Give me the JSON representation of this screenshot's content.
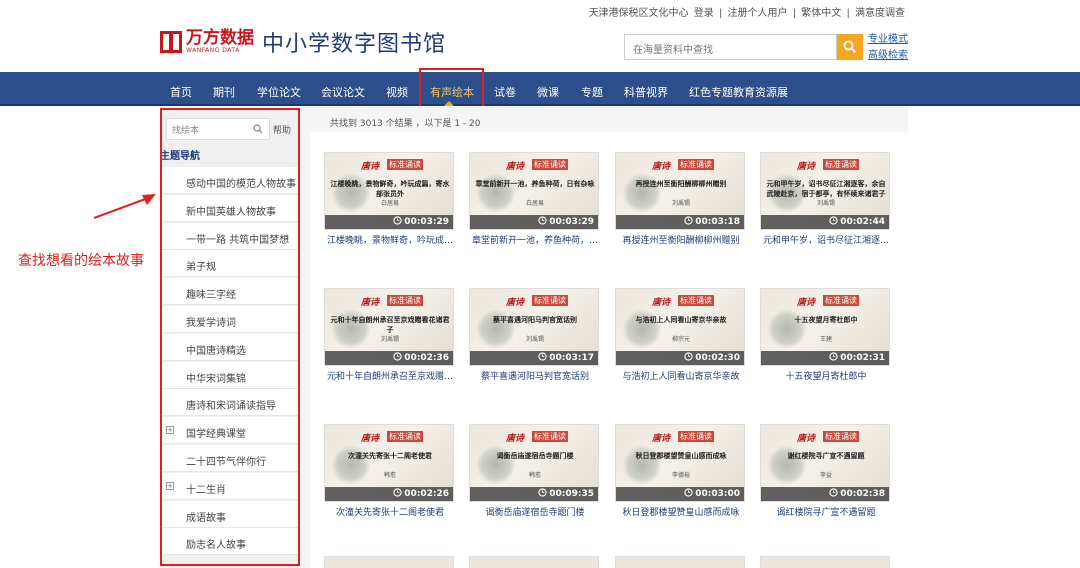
{
  "top_links": [
    "天津港保税区文化中心",
    "登录",
    "|",
    "注册个人用户",
    "|",
    "繁体中文",
    "|",
    "满意度调查"
  ],
  "logo": {
    "brand_cn": "万方数据",
    "brand_en": "WANFANG DATA",
    "title": "中小学数字图书馆"
  },
  "search": {
    "placeholder": "在海量资料中查找",
    "pro_mode": "专业模式",
    "advanced": "高级检索"
  },
  "nav": {
    "items": [
      "首页",
      "期刊",
      "学位论文",
      "会议论文",
      "视频",
      "有声绘本",
      "试卷",
      "微课",
      "专题",
      "科普视界",
      "红色专题教育资源展"
    ],
    "active": "有声绘本"
  },
  "sidebar": {
    "search_placeholder": "找绘本",
    "help": "帮助",
    "header": "主题导航",
    "items": [
      {
        "label": "感动中国的模范人物故事",
        "expandable": false
      },
      {
        "label": "新中国英雄人物故事",
        "expandable": false
      },
      {
        "label": "一带一路 共筑中国梦想",
        "expandable": false
      },
      {
        "label": "弟子规",
        "expandable": false
      },
      {
        "label": "趣味三字经",
        "expandable": false
      },
      {
        "label": "我爱学诗词",
        "expandable": false
      },
      {
        "label": "中国唐诗精选",
        "expandable": false
      },
      {
        "label": "中华宋词集锦",
        "expandable": false
      },
      {
        "label": "唐诗和宋词诵读指导",
        "expandable": false
      },
      {
        "label": "国学经典课堂",
        "expandable": true
      },
      {
        "label": "二十四节气伴你行",
        "expandable": false
      },
      {
        "label": "十二生肖",
        "expandable": true
      },
      {
        "label": "成语故事",
        "expandable": false
      },
      {
        "label": "励志名人故事",
        "expandable": false
      }
    ]
  },
  "results": {
    "info": "共找到 3013 个结果 ，以下是 1 - 20"
  },
  "thumb_brand": {
    "script": "唐诗",
    "tag": "标准诵读"
  },
  "cards": [
    {
      "poem": "江楼晚眺，景物鲜奇，吟玩成篇，寄水部张员外",
      "author": "白居易",
      "duration": "00:03:29",
      "caption": "江楼晚眺，景物鲜奇，吟玩成…"
    },
    {
      "poem": "章堂前新开一池，养鱼种荷，日有杂咏",
      "author": "白居易",
      "duration": "00:03:29",
      "caption": "章堂前新开一池，养鱼种荷，…"
    },
    {
      "poem": "再授连州至衡阳酬柳柳州赠别",
      "author": "刘禹锡",
      "duration": "00:03:18",
      "caption": "再授连州至衡阳酬柳柳州赠别"
    },
    {
      "poem": "元和甲午岁，诏书尽征江湘逐客，余自武陵赴京，宿于都亭，有怀续来诸君子",
      "author": "刘禹锡",
      "duration": "00:02:44",
      "caption": "元和甲午岁，诏书尽征江湘逐…"
    },
    {
      "poem": "元和十年自朗州承召至京戏赠看花诸君子",
      "author": "刘禹锡",
      "duration": "00:02:36",
      "caption": "元和十年自朗州承召至京戏赠…"
    },
    {
      "poem": "蔡平喜遇河阳马判官宽话别",
      "author": "刘禹锡",
      "duration": "00:03:17",
      "caption": "蔡平喜遇河阳马判官宽话别"
    },
    {
      "poem": "与浩初上人同看山寄京华亲故",
      "author": "柳宗元",
      "duration": "00:02:30",
      "caption": "与浩初上人同看山寄京华亲故"
    },
    {
      "poem": "十五夜望月寄杜郎中",
      "author": "王建",
      "duration": "00:02:31",
      "caption": "十五夜望月寄杜郎中"
    },
    {
      "poem": "次潼关先寄张十二阁老使君",
      "author": "韩愈",
      "duration": "00:02:26",
      "caption": "次潼关先寄张十二阁老使君"
    },
    {
      "poem": "谒衡岳庙遂宿岳寺题门楼",
      "author": "韩愈",
      "duration": "00:09:35",
      "caption": "谒衡岳庙遂宿岳寺题门楼"
    },
    {
      "poem": "秋日登郡楼望赞皇山感而成咏",
      "author": "李德裕",
      "duration": "00:03:00",
      "caption": "秋日登郡楼望赞皇山感而成咏"
    },
    {
      "poem": "谢红楼院寻广宣不遇留题",
      "author": "李益",
      "duration": "00:02:38",
      "caption": "谒红楼院寻广宣不遇留题"
    }
  ],
  "annotation": {
    "text": "查找想看的绘本故事",
    "color": "#e02020"
  },
  "colors": {
    "nav_bg": "#2c4f8c",
    "accent": "#f5a623",
    "highlight": "#e02020",
    "link": "#1f3d7a"
  }
}
